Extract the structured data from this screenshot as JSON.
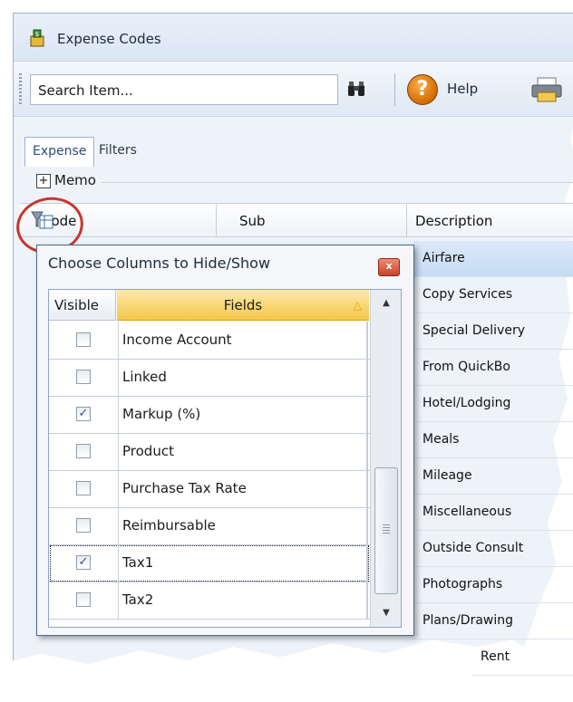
{
  "window": {
    "title": "Expense Codes"
  },
  "toolbar": {
    "search_text": "Search Item...",
    "help_label": "Help"
  },
  "tabs": [
    {
      "label": "Expense",
      "active": true
    },
    {
      "label": "Filters",
      "active": false
    }
  ],
  "memo": {
    "label": "Memo"
  },
  "grid": {
    "columns": [
      "Code",
      "Sub",
      "Description"
    ],
    "descriptions": [
      "Airfare",
      "Copy Services",
      "Special Delivery",
      "From QuickBo",
      "Hotel/Lodging",
      "Meals",
      "Mileage",
      "Miscellaneous",
      "Outside Consult",
      "Photographs",
      "Plans/Drawing",
      "Rent"
    ],
    "selected_index": 0
  },
  "popup": {
    "title": "Choose Columns to Hide/Show",
    "close_glyph": "x",
    "header_visible": "Visible",
    "header_fields": "Fields",
    "rows": [
      {
        "field": "Income Account",
        "visible": false
      },
      {
        "field": "Linked",
        "visible": false
      },
      {
        "field": "Markup (%)",
        "visible": true
      },
      {
        "field": "Product",
        "visible": false
      },
      {
        "field": "Purchase Tax Rate",
        "visible": false
      },
      {
        "field": "Reimbursable",
        "visible": false
      },
      {
        "field": "Tax1",
        "visible": true
      },
      {
        "field": "Tax2",
        "visible": false
      }
    ],
    "focused_index": 6
  },
  "colors": {
    "accent_selected": "#c6dcf4",
    "fields_header": "#f6c84a",
    "highlight_circle": "#c9342e"
  }
}
